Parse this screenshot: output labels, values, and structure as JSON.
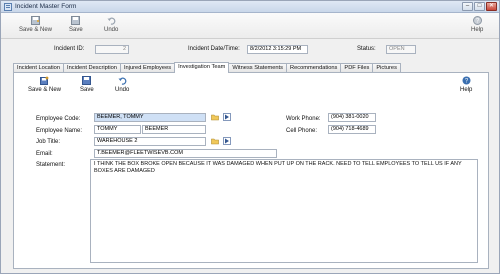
{
  "window": {
    "title": "Incident Master Form",
    "controls": {
      "minimize": "–",
      "maximize": "□",
      "close": "✕"
    }
  },
  "toolbar": {
    "save_new": "Save & New",
    "save": "Save",
    "undo": "Undo",
    "help": "Help"
  },
  "header": {
    "incident_id_label": "Incident ID:",
    "incident_id_value": "2",
    "incident_datetime_label": "Incident Date/Time:",
    "incident_datetime_value": "8/2/2012 3:15:29 PM",
    "status_label": "Status:",
    "status_value": "OPEN"
  },
  "tabs": [
    {
      "label": "Incident Location"
    },
    {
      "label": "Incident Description"
    },
    {
      "label": "Injured Employees"
    },
    {
      "label": "Investigation Team",
      "active": true
    },
    {
      "label": "Witness Statements"
    },
    {
      "label": "Recommendations"
    },
    {
      "label": "PDF Files"
    },
    {
      "label": "Pictures"
    }
  ],
  "subtoolbar": {
    "save_new": "Save & New",
    "save": "Save",
    "undo": "Undo",
    "help": "Help"
  },
  "form": {
    "employee_code_label": "Employee Code:",
    "employee_code_value": "BEEMER, TOMMY",
    "employee_name_label": "Employee Name:",
    "first_name_value": "TOMMY",
    "last_name_value": "BEEMER",
    "job_title_label": "Job Title:",
    "job_title_value": "WAREHOUSE 2",
    "email_label": "Email:",
    "email_value": "T.BEEMER@FLEETWISEVB.COM",
    "statement_label": "Statement:",
    "statement_value": "I THINK THE BOX BROKE OPEN BECAUSE IT WAS DAMAGED WHEN PUT UP ON THE RACK.  NEED TO TELL EMPLOYEES TO TELL US IF ANY BOXES ARE DAMAGED",
    "work_phone_label": "Work Phone:",
    "work_phone_value": "(904) 381-0020",
    "cell_phone_label": "Cell Phone:",
    "cell_phone_value": "(904) 718-4689"
  },
  "icons": {
    "folder": "folder-icon",
    "lookup": "lookup-icon"
  },
  "colors": {
    "accent": "#3a6fb0",
    "selection": "#cfe0f5"
  }
}
